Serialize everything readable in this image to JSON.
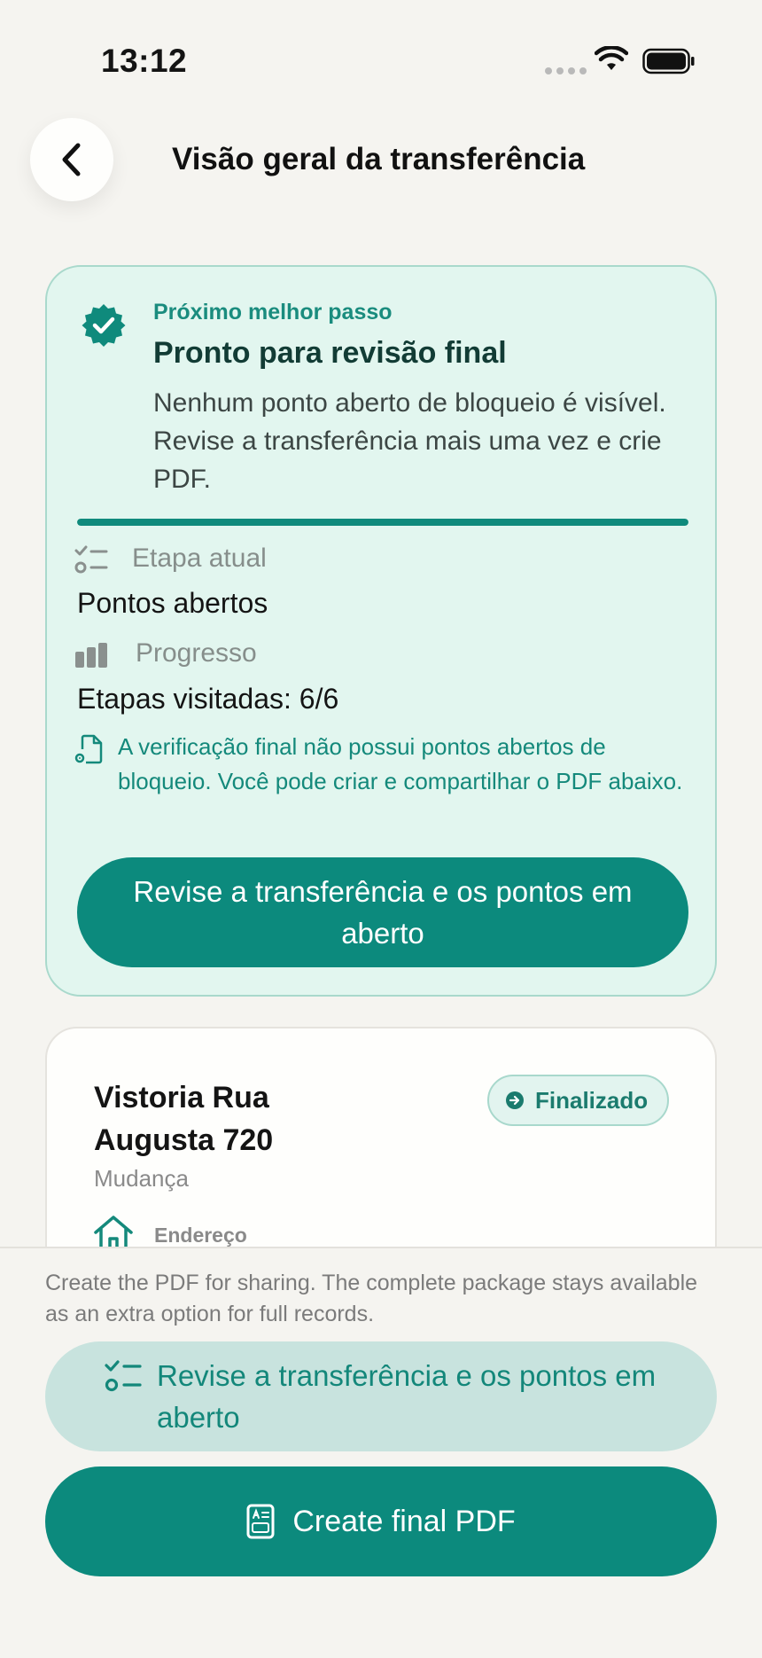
{
  "status_bar": {
    "time": "13:12"
  },
  "header": {
    "title": "Visão geral da transferência",
    "back_icon": "chevron-left-icon"
  },
  "hero": {
    "eyebrow": "Próximo melhor passo",
    "title": "Pronto para revisão final",
    "description": "Nenhum ponto aberto de bloqueio é visível. Revise a transferência mais uma vez e crie PDF.",
    "progress_fraction": 1.0,
    "current_step_label": "Etapa atual",
    "current_step_value": "Pontos abertos",
    "progress_label": "Progresso",
    "progress_value": "Etapas visitadas: 6/6",
    "note": "A verificação final não possui pontos abertos de bloqueio. Você pode criar e compartilhar o PDF abaixo.",
    "action_label": "Revise a transferência e os pontos em aberto"
  },
  "transfer": {
    "title": "Vistoria Rua Augusta 720",
    "subtitle": "Mudança",
    "status": "Finalizado",
    "address_label": "Endereço"
  },
  "bottom": {
    "hint": "Create the PDF for sharing. The complete package stays available as an extra option for full records.",
    "secondary_label": "Revise a transferência e os pontos em aberto",
    "primary_label": "Create final PDF"
  },
  "colors": {
    "accent": "#0c8a7d",
    "hero_bg": "#e2f6ef",
    "page_bg": "#f5f4f0"
  }
}
